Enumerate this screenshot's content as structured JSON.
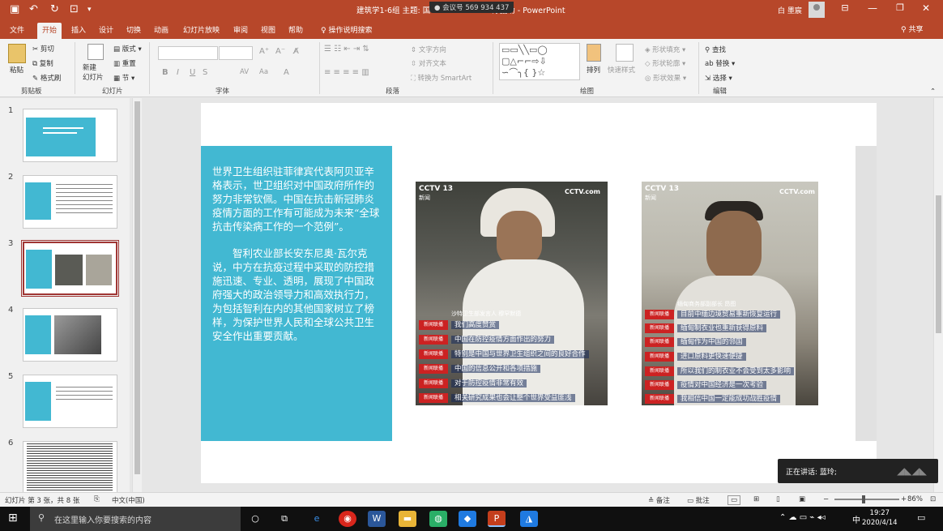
{
  "window": {
    "title": "建筑学1-6组 主题: 国",
    "title_tail": "际援助 - PowerPoint",
    "meeting": "会议号 569 934 437",
    "user": "白 墨宸",
    "accent": "#b7472a"
  },
  "tabs": [
    "文件",
    "开始",
    "插入",
    "设计",
    "切换",
    "动画",
    "幻灯片放映",
    "审阅",
    "视图",
    "帮助",
    "操作说明搜索"
  ],
  "active_tab": "开始",
  "share": "共享",
  "ribbon": {
    "clipboard": {
      "paste": "粘贴",
      "cut": "剪切",
      "copy": "复制",
      "format_painter": "格式刷",
      "label": "剪贴板"
    },
    "slides": {
      "new_slide": "新建\n幻灯片",
      "layout": "版式",
      "reset": "重置",
      "section": "节",
      "label": "幻灯片"
    },
    "font": {
      "bold": "B",
      "italic": "I",
      "underline": "U",
      "strike": "S",
      "spacing": "AV",
      "case": "Aa",
      "label": "字体"
    },
    "paragraph": {
      "text_direction": "文字方向",
      "align_text": "对齐文本",
      "smartart": "转换为 SmartArt",
      "label": "段落"
    },
    "drawing": {
      "arrange": "排列",
      "quick_styles": "快速样式",
      "shape_fill": "形状填充",
      "shape_outline": "形状轮廓",
      "shape_effects": "形状效果",
      "label": "绘图"
    },
    "editing": {
      "find": "查找",
      "replace": "替换",
      "select": "选择",
      "label": "编辑"
    }
  },
  "thumbnails": [
    {
      "num": "1"
    },
    {
      "num": "2"
    },
    {
      "num": "3",
      "selected": true
    },
    {
      "num": "4"
    },
    {
      "num": "5"
    },
    {
      "num": "6"
    }
  ],
  "slide": {
    "para1": "世界卫生组织驻菲律宾代表阿贝亚辛格表示，世卫组织对中国政府所作的努力非常钦佩。中国在抗击新冠肺炎疫情方面的工作有可能成为未来“全球抗击传染病工作的一个范例”。",
    "para2": "智利农业部长安东尼奥·瓦尔克说，中方在抗疫过程中采取的防控措施迅速、专业、透明，展现了中国政府强大的政治领导力和高效执行力，为包括智利在内的其他国家树立了榜样，为保护世界人民和全球公共卫生安全作出重要贡献。",
    "photo1": {
      "channel": "CCTV 13",
      "channel_sub": "新闻",
      "watermark": "CCTV.com",
      "caption": "沙特卫生部发言人 穆罕默德",
      "lines": [
        "我们高度赞赏",
        "中国在防控疫情方面作出的努力",
        "特别是中国与世界卫生组织之间的良好合作",
        "中国的信息公开和各项措施",
        "对于防控疫情非常有效",
        "相关研究成果也会让整个世界受益匪浅"
      ]
    },
    "photo2": {
      "channel": "CCTV 13",
      "channel_sub": "新闻",
      "watermark": "CCTV.com",
      "caption": "缅甸商务部副部长 昂图",
      "lines": [
        "目前中缅边境贸易重新恢复运行",
        "缅甸制衣业也重新获得原料",
        "缅甸作为中国的邻国",
        "进口原料更快速便捷",
        "所以我们的制衣业不会受到太多影响",
        "疫情对中国经济是一次考验",
        "我相信中国一定能成功战胜疫情"
      ]
    },
    "tag_label": "新闻联播"
  },
  "toast": "正在讲话: 蓝玲;",
  "status": {
    "slide_count": "幻灯片 第 3 张，共 8 张",
    "language": "中文(中国)",
    "notes": "备注",
    "comments": "批注",
    "zoom": "86%"
  },
  "taskbar": {
    "search_placeholder": "在这里输入你要搜索的内容",
    "ime": "中",
    "time": "19:27",
    "date": "2020/4/14"
  }
}
